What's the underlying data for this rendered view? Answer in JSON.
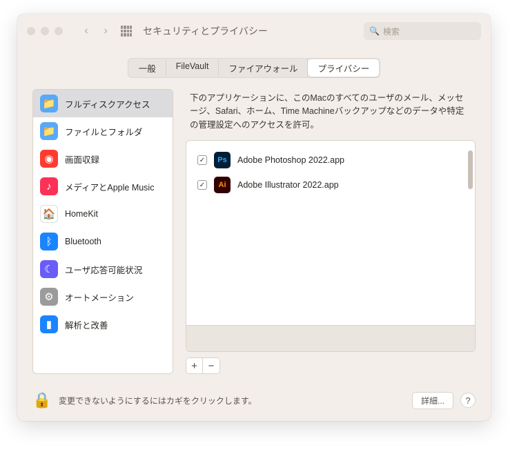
{
  "window": {
    "title": "セキュリティとプライバシー"
  },
  "search": {
    "placeholder": "検索"
  },
  "tabs": [
    {
      "label": "一般"
    },
    {
      "label": "FileVault"
    },
    {
      "label": "ファイアウォール"
    },
    {
      "label": "プライバシー",
      "active": true
    }
  ],
  "sidebar": {
    "items": [
      {
        "label": "フルディスクアクセス",
        "bg": "#5aa9f7",
        "glyph": "📁",
        "selected": true
      },
      {
        "label": "ファイルとフォルダ",
        "bg": "#5aa9f7",
        "glyph": "📁"
      },
      {
        "label": "画面収録",
        "bg": "#fe3b30",
        "glyph": "◉"
      },
      {
        "label": "メディアとApple Music",
        "bg": "#fc3158",
        "glyph": "♪"
      },
      {
        "label": "HomeKit",
        "bg": "#ffffff",
        "glyph": "🏠",
        "border": true
      },
      {
        "label": "Bluetooth",
        "bg": "#1b84ff",
        "glyph": "ᛒ"
      },
      {
        "label": "ユーザ応答可能状況",
        "bg": "#6a5cf7",
        "glyph": "☾"
      },
      {
        "label": "オートメーション",
        "bg": "#9b9b9b",
        "glyph": "⚙"
      },
      {
        "label": "解析と改善",
        "bg": "#1b84ff",
        "glyph": "▮"
      }
    ]
  },
  "main": {
    "description": "下のアプリケーションに、このMacのすべてのユーザのメール、メッセージ、Safari、ホーム、Time Machineバックアップなどのデータや特定の管理設定へのアクセスを許可。",
    "apps": [
      {
        "name": "Adobe Photoshop 2022.app",
        "checked": true,
        "icon": {
          "bg": "#001e36",
          "fg": "#31a8ff",
          "text": "Ps"
        }
      },
      {
        "name": "Adobe Illustrator 2022.app",
        "checked": true,
        "icon": {
          "bg": "#330000",
          "fg": "#ff9a00",
          "text": "Ai"
        }
      }
    ]
  },
  "footer": {
    "lock_text": "変更できないようにするにはカギをクリックします。",
    "details": "詳細...",
    "help": "?"
  }
}
